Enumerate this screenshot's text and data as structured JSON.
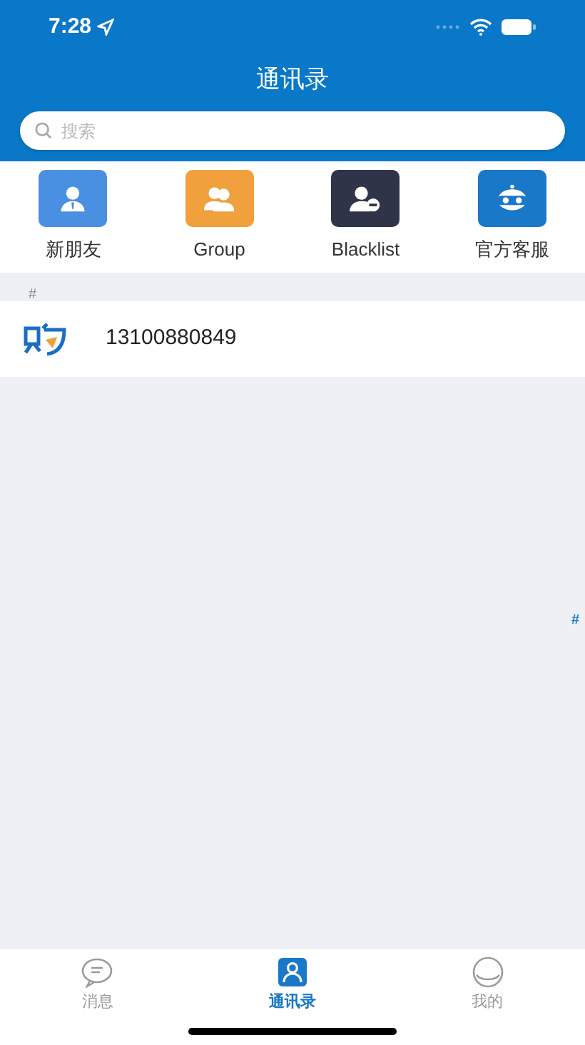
{
  "status_bar": {
    "time": "7:28"
  },
  "title": "通讯录",
  "search": {
    "placeholder": "搜索"
  },
  "shortcuts": [
    {
      "label": "新朋友",
      "color": "#4a90e2"
    },
    {
      "label": "Group",
      "color": "#f0a03c"
    },
    {
      "label": "Blacklist",
      "color": "#2f3448"
    },
    {
      "label": "官方客服",
      "color": "#1a78c8"
    }
  ],
  "sections": [
    {
      "header": "#",
      "contacts": [
        {
          "name": "13100880849"
        }
      ]
    }
  ],
  "index": [
    "#"
  ],
  "tab_bar": [
    {
      "label": "消息",
      "selected": false
    },
    {
      "label": "通讯录",
      "selected": true
    },
    {
      "label": "我的",
      "selected": false
    }
  ]
}
